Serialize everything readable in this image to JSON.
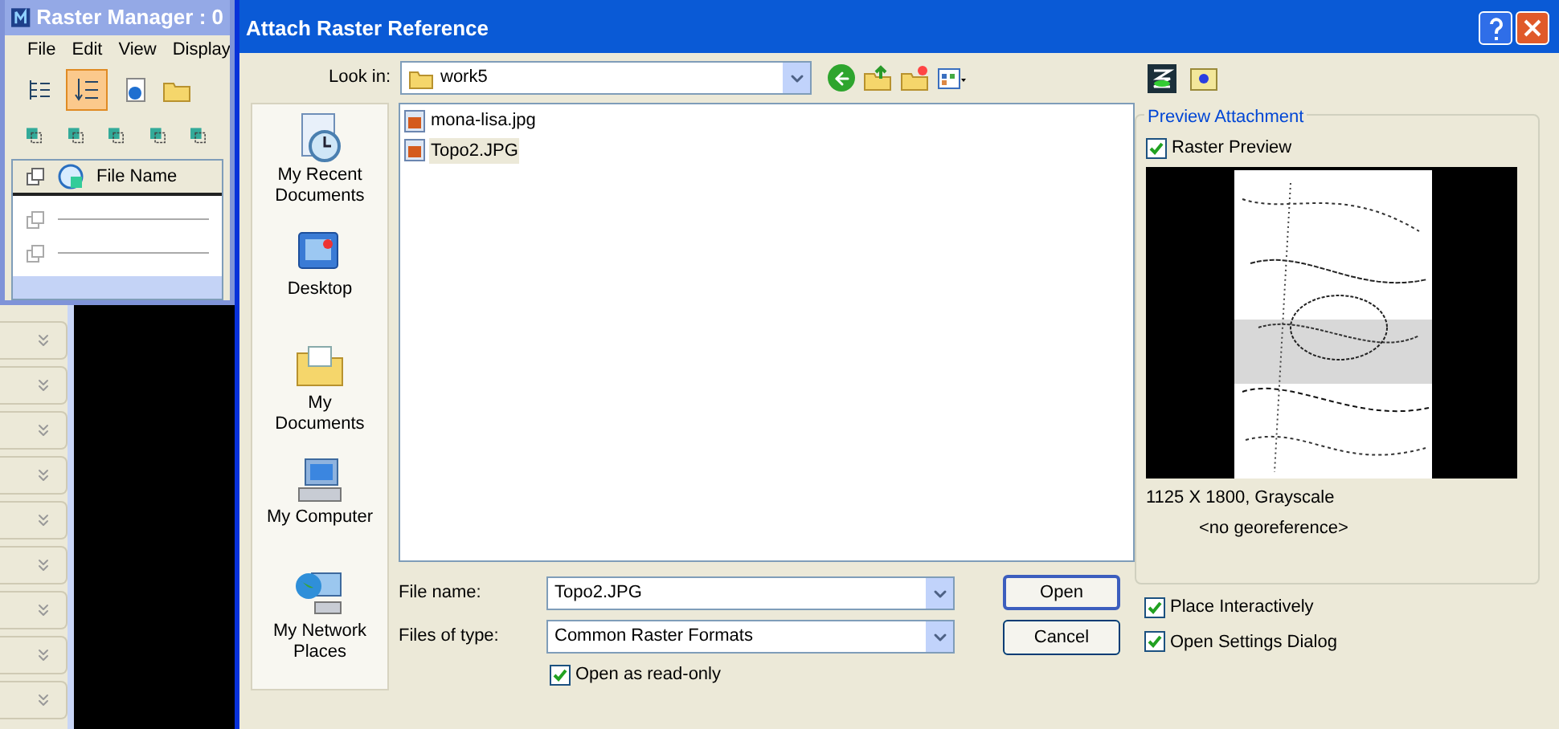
{
  "raster_manager": {
    "title": "Raster Manager : 0",
    "menu": [
      "File",
      "Edit",
      "View",
      "Display"
    ],
    "column_header": "File Name"
  },
  "dialog": {
    "title": "Attach Raster Reference",
    "look_in": {
      "label": "Look in:",
      "value": "work5"
    },
    "places": [
      {
        "kind": "recent",
        "label": "My Recent Documents"
      },
      {
        "kind": "desktop",
        "label": "Desktop"
      },
      {
        "kind": "documents",
        "label": "My Documents"
      },
      {
        "kind": "computer",
        "label": "My Computer"
      },
      {
        "kind": "network",
        "label": "My Network Places"
      }
    ],
    "files": [
      {
        "name": "mona-lisa.jpg",
        "selected": false
      },
      {
        "name": "Topo2.JPG",
        "selected": true
      }
    ],
    "file_name": {
      "label": "File name:",
      "value": "Topo2.JPG"
    },
    "file_type": {
      "label": "Files of type:",
      "value": "Common Raster Formats"
    },
    "read_only": {
      "label": "Open as read-only",
      "checked": true
    },
    "buttons": [
      {
        "label": "Open",
        "default": true
      },
      {
        "label": "Cancel",
        "default": false
      }
    ],
    "preview": {
      "title": "Preview Attachment",
      "raster_preview": {
        "label": "Raster Preview",
        "checked": true
      },
      "info": "1125 X 1800, Grayscale",
      "georef": "<no georeference>"
    },
    "options": [
      {
        "label": "Place Interactively",
        "checked": true
      },
      {
        "label": "Open Settings Dialog",
        "checked": true
      }
    ]
  }
}
